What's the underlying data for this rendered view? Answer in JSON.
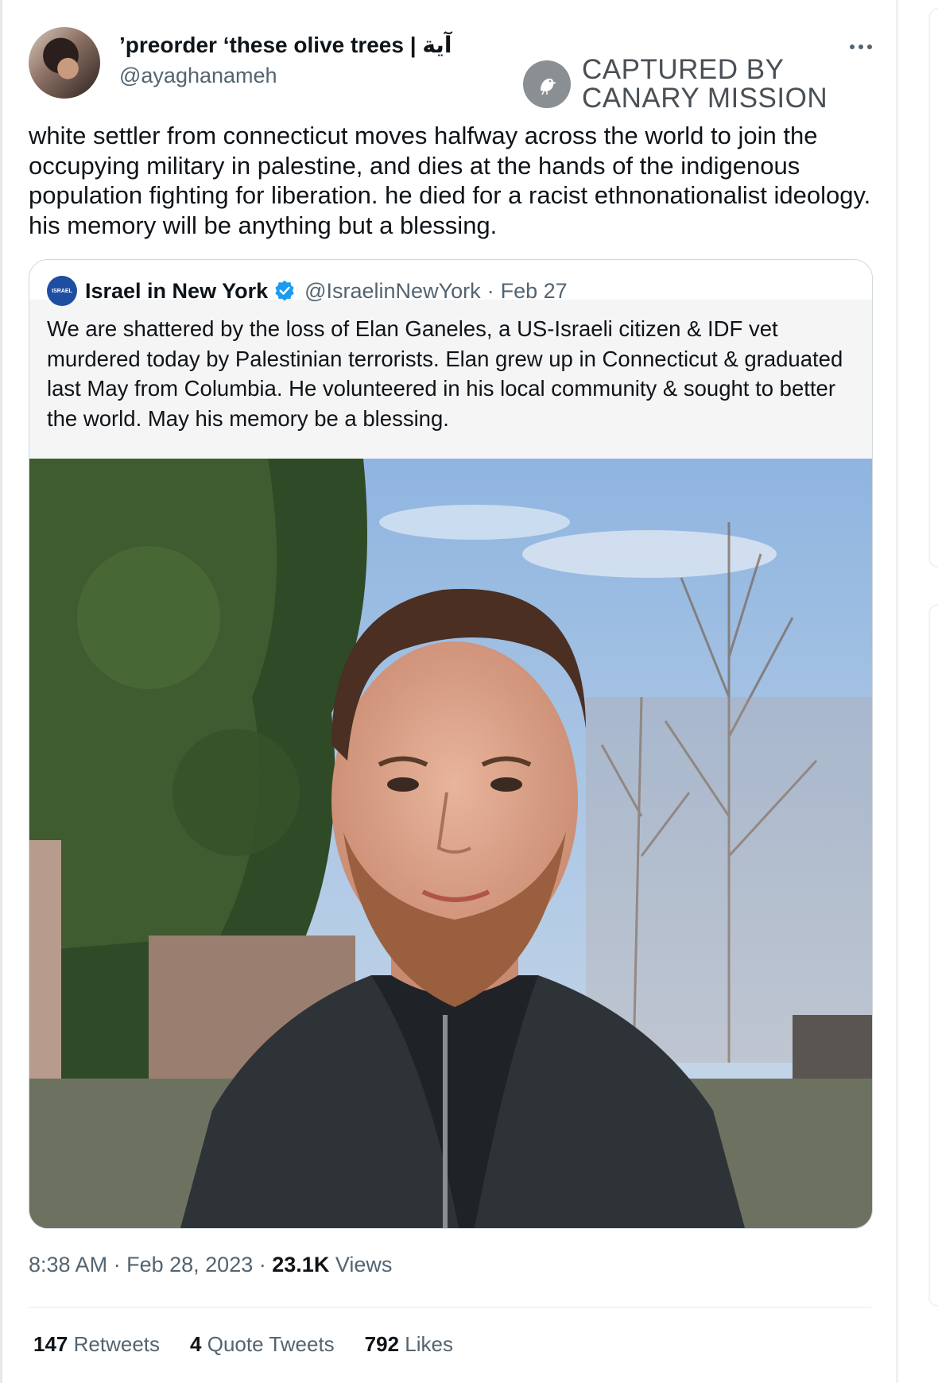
{
  "author": {
    "display_name": "آية | preorder ‘these olive trees’",
    "handle": "@ayaghanameh"
  },
  "watermark": {
    "line1": "CAPTURED BY",
    "line2": "CANARY MISSION"
  },
  "tweet": {
    "text": "white settler from connecticut moves halfway across the world to join the occupying military in palestine, and dies at the hands of the indigenous population fighting for liberation. he died for a racist ethnonationalist ideology. his memory will be anything but a blessing."
  },
  "quoted": {
    "display_name": "Israel in New York",
    "handle": "@IsraelinNewYork",
    "separator": "·",
    "date": "Feb 27",
    "avatar_text": "ISRAEL",
    "text": "We are shattered by the loss of Elan Ganeles, a US-Israeli citizen & IDF vet murdered today by Palestinian terrorists. Elan grew up in Connecticut & graduated last May from Columbia. He volunteered in his local community & sought to better the world. May his memory be a blessing."
  },
  "meta": {
    "time": "8:38 AM",
    "sep1": "·",
    "date": "Feb 28, 2023",
    "sep2": "·",
    "views_count": "23.1K",
    "views_label": "Views"
  },
  "stats": {
    "retweets_count": "147",
    "retweets_label": "Retweets",
    "quotes_count": "4",
    "quotes_label": "Quote Tweets",
    "likes_count": "792",
    "likes_label": "Likes"
  },
  "colors": {
    "verified": "#1d9bf0",
    "secondary_text": "#536471",
    "primary_text": "#0f1419"
  },
  "icons": {
    "more": "more-horizontal-icon",
    "verified": "verified-badge-icon",
    "watermark": "canary-bird-icon"
  }
}
